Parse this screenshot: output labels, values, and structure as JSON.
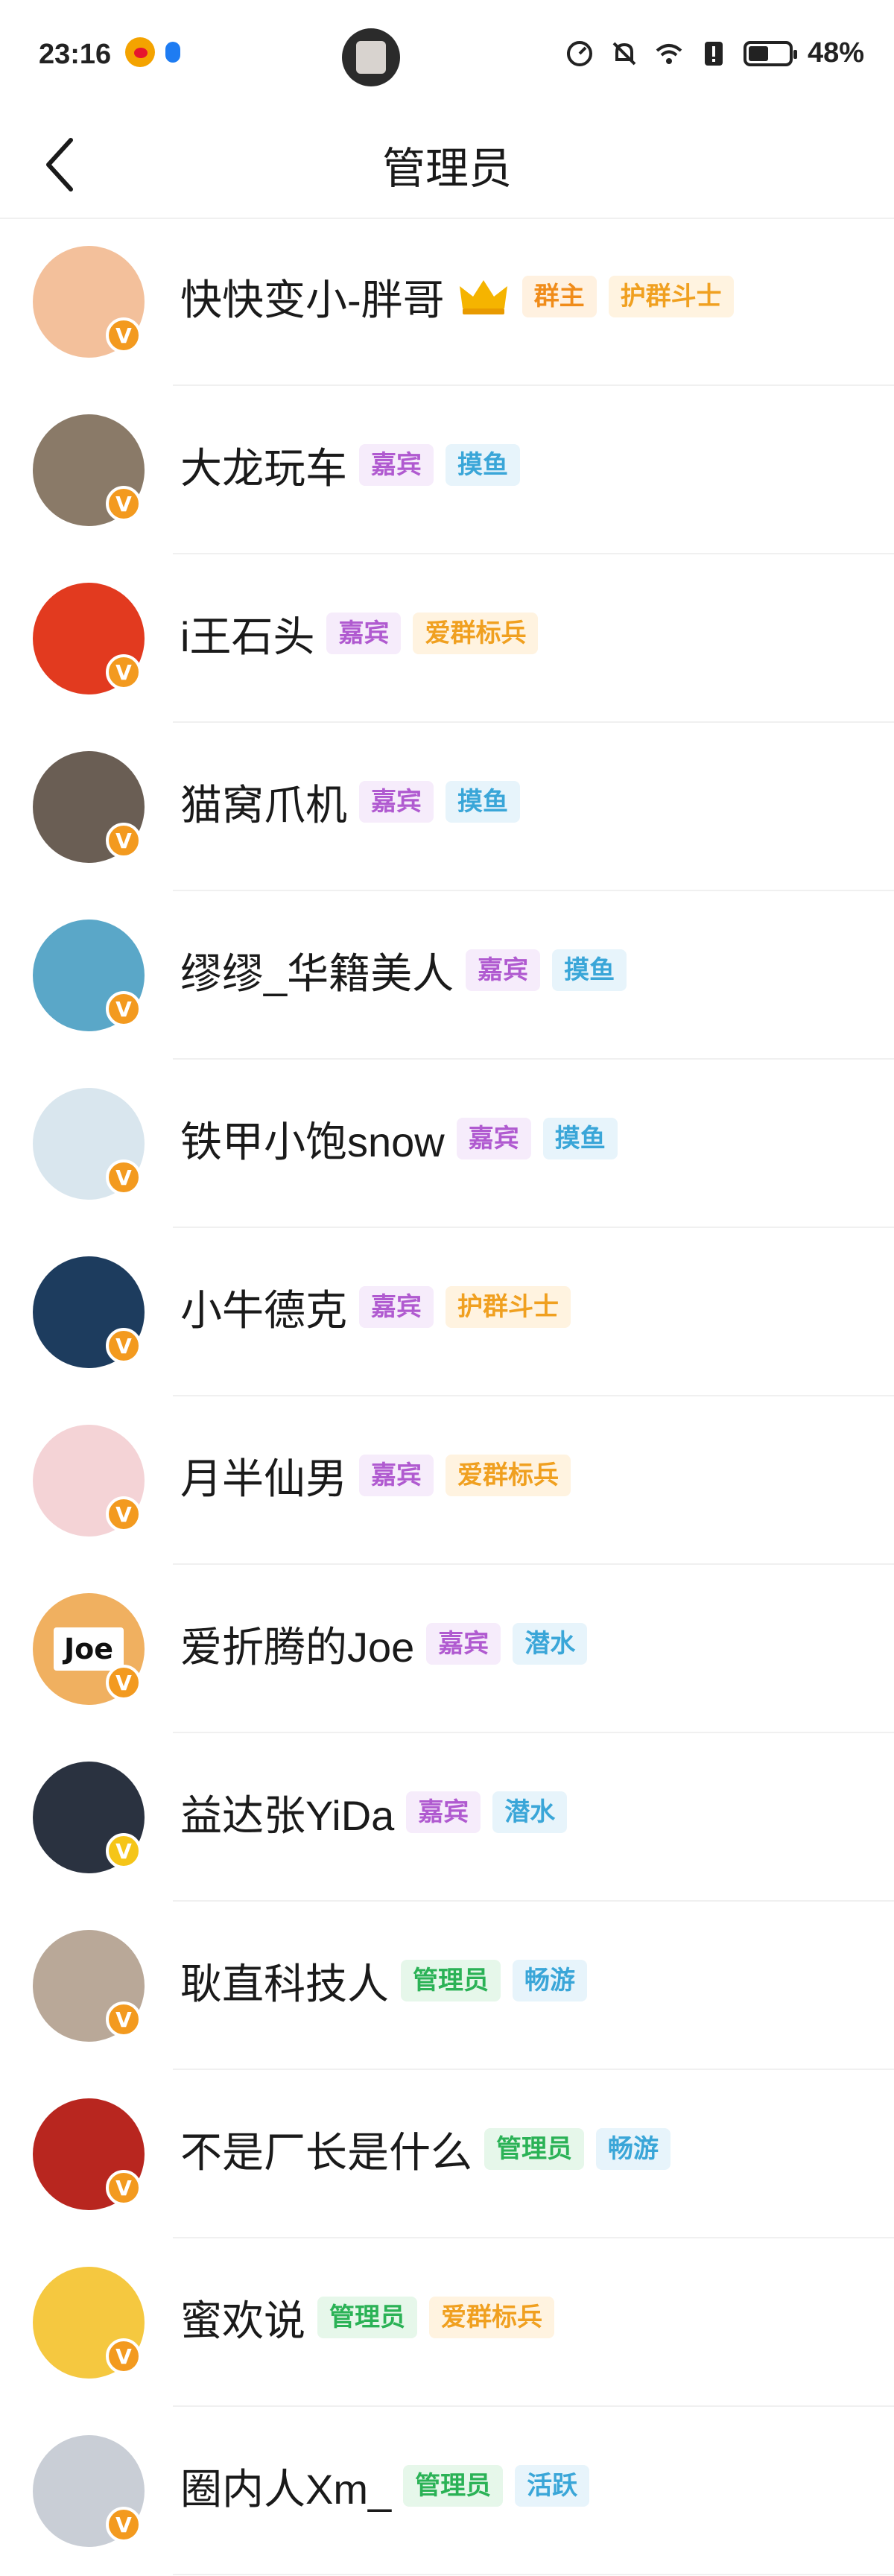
{
  "status_bar": {
    "time": "23:16",
    "battery": "48%",
    "icons": [
      "weibo-icon",
      "bluetooth-icon",
      "speed-icon",
      "mute-bell-icon",
      "wifi-icon",
      "alert-icon",
      "battery-icon"
    ]
  },
  "nav": {
    "title": "管理员",
    "back_icon": "chevron-left-icon"
  },
  "tag_colors": {
    "群主": {
      "bg": "#fff1e0",
      "fg": "#f08c1a"
    },
    "护群斗士": {
      "bg": "#fff3e0",
      "fg": "#f0a020"
    },
    "嘉宾": {
      "bg": "#f6ecfb",
      "fg": "#b05ad0"
    },
    "摸鱼": {
      "bg": "#e7f4fb",
      "fg": "#3aa6d8"
    },
    "爱群标兵": {
      "bg": "#fff3e0",
      "fg": "#f0a020"
    },
    "潜水": {
      "bg": "#e7f4fb",
      "fg": "#3aa6d8"
    },
    "管理员": {
      "bg": "#e6f7ea",
      "fg": "#2bb256"
    },
    "畅游": {
      "bg": "#e7f4fb",
      "fg": "#3aa6d8"
    },
    "活跃": {
      "bg": "#e7f4fb",
      "fg": "#3aa6d8"
    }
  },
  "members": [
    {
      "name": "快快变小-胖哥",
      "crown": true,
      "tags": [
        "群主",
        "护群斗士"
      ],
      "avatar_color": "#f3c09b",
      "badge": "V"
    },
    {
      "name": "大龙玩车",
      "crown": false,
      "tags": [
        "嘉宾",
        "摸鱼"
      ],
      "avatar_color": "#8a7a68",
      "badge": "V"
    },
    {
      "name": "i王石头",
      "crown": false,
      "tags": [
        "嘉宾",
        "爱群标兵"
      ],
      "avatar_color": "#e23a1f",
      "badge": "V"
    },
    {
      "name": "猫窝爪机",
      "crown": false,
      "tags": [
        "嘉宾",
        "摸鱼"
      ],
      "avatar_color": "#6a5e54",
      "badge": "V"
    },
    {
      "name": "缪缪_华籍美人",
      "crown": false,
      "tags": [
        "嘉宾",
        "摸鱼"
      ],
      "avatar_color": "#5aa7c8",
      "badge": "V"
    },
    {
      "name": "铁甲小饱snow",
      "crown": false,
      "tags": [
        "嘉宾",
        "摸鱼"
      ],
      "avatar_color": "#d9e6ee",
      "badge": "V"
    },
    {
      "name": "小牛德克",
      "crown": false,
      "tags": [
        "嘉宾",
        "护群斗士"
      ],
      "avatar_color": "#1d3c5e",
      "badge": "V"
    },
    {
      "name": "月半仙男",
      "crown": false,
      "tags": [
        "嘉宾",
        "爱群标兵"
      ],
      "avatar_color": "#f4d3d6",
      "badge": "V"
    },
    {
      "name": "爱折腾的Joe",
      "crown": false,
      "tags": [
        "嘉宾",
        "潜水"
      ],
      "avatar_color": "#f0b060",
      "badge": "V",
      "avatar_text": "Joe"
    },
    {
      "name": "益达张YiDa",
      "crown": false,
      "tags": [
        "嘉宾",
        "潜水"
      ],
      "avatar_color": "#2a3240",
      "badge": "V",
      "badge_yellow": true
    },
    {
      "name": "耿直科技人",
      "crown": false,
      "tags": [
        "管理员",
        "畅游"
      ],
      "avatar_color": "#b9a898",
      "badge": "V"
    },
    {
      "name": "不是厂长是什么",
      "crown": false,
      "tags": [
        "管理员",
        "畅游"
      ],
      "avatar_color": "#b8261f",
      "badge": "V"
    },
    {
      "name": "蜜欢说",
      "crown": false,
      "tags": [
        "管理员",
        "爱群标兵"
      ],
      "avatar_color": "#f5c840",
      "badge": "V"
    },
    {
      "name": "圈内人Xm_",
      "crown": false,
      "tags": [
        "管理员",
        "活跃"
      ],
      "avatar_color": "#c9ced6",
      "badge": "V"
    }
  ]
}
